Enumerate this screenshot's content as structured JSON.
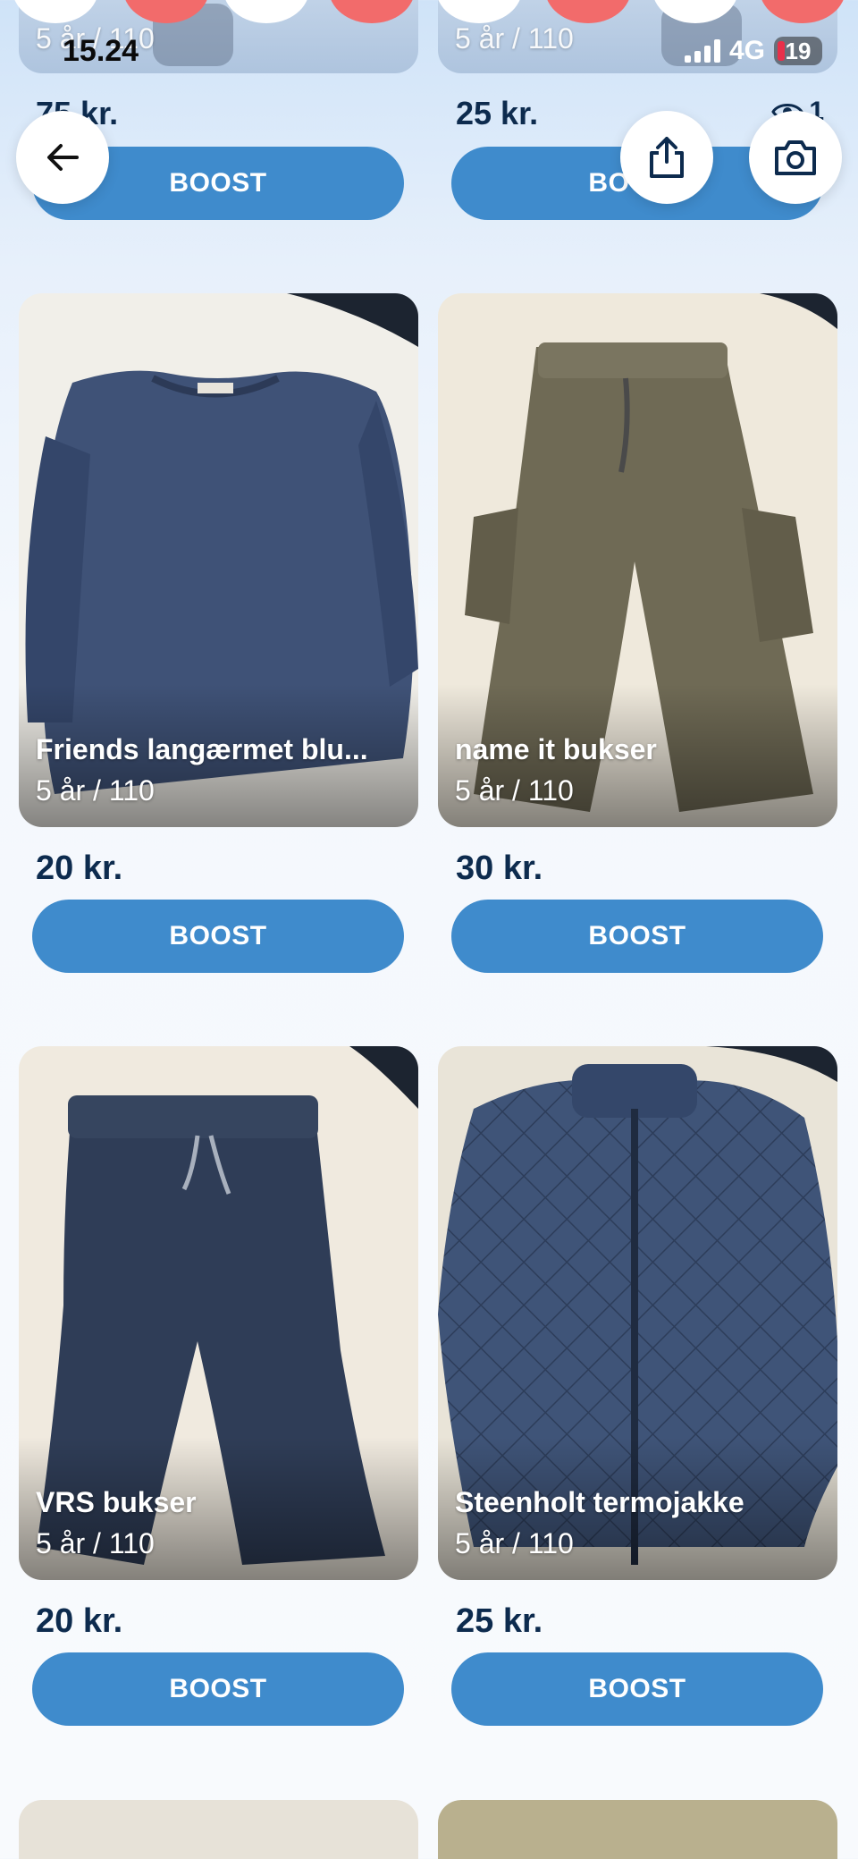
{
  "status": {
    "time": "15.24",
    "network": "4G",
    "battery": "19"
  },
  "top_row": {
    "left": {
      "size": "5 år / 110",
      "price": "75 kr."
    },
    "right": {
      "size": "5 år / 110",
      "price": "25 kr.",
      "views": "1"
    },
    "boost_label": "BOOST"
  },
  "overlay": {
    "back_icon": "arrow-left-icon",
    "share_icon": "share-icon",
    "camera_icon": "camera-icon"
  },
  "listings": [
    {
      "title": "Friends langærmet blu...",
      "size": "5 år / 110",
      "price": "20 kr.",
      "boost_label": "BOOST"
    },
    {
      "title": "name it bukser",
      "size": "5 år / 110",
      "price": "30 kr.",
      "boost_label": "BOOST"
    },
    {
      "title": "VRS bukser",
      "size": "5 år / 110",
      "price": "20 kr.",
      "boost_label": "BOOST"
    },
    {
      "title": "Steenholt termojakke",
      "size": "5 år / 110",
      "price": "25 kr.",
      "boost_label": "BOOST"
    }
  ],
  "colors": {
    "boost": "#3f8bcc",
    "price_text": "#0d2b4e"
  }
}
